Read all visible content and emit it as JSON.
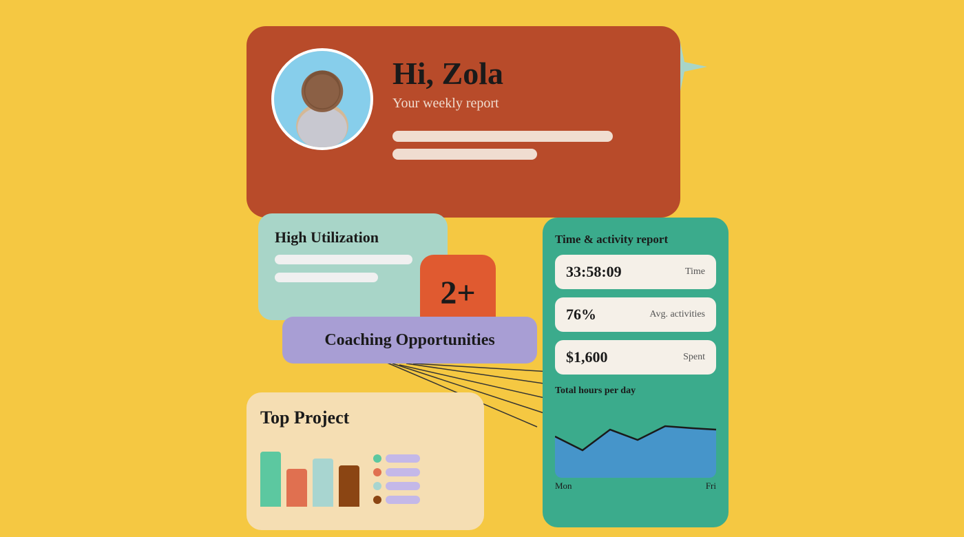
{
  "greeting": {
    "hi_text": "Hi, Zola",
    "subtitle": "Your weekly report"
  },
  "high_utilization": {
    "title": "High Utilization"
  },
  "badge": {
    "value": "2+"
  },
  "coaching": {
    "label": "Coaching Opportunities"
  },
  "time_activity": {
    "title": "Time & activity report",
    "stats": [
      {
        "value": "33:58:09",
        "label": "Time"
      },
      {
        "value": "76%",
        "label": "Avg. activities"
      },
      {
        "value": "$1,600",
        "label": "Spent"
      }
    ],
    "chart_title": "Total hours per day",
    "chart_x_start": "Mon",
    "chart_x_end": "Fri"
  },
  "top_project": {
    "title": "Top Project"
  }
}
